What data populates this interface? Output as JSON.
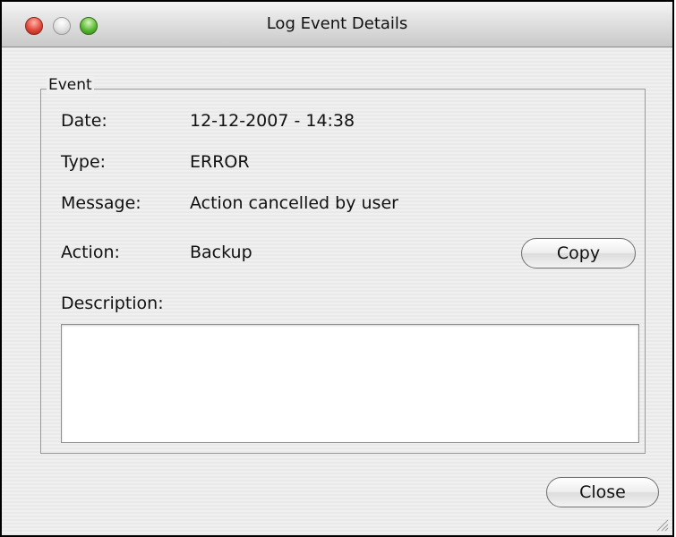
{
  "window": {
    "title": "Log Event Details"
  },
  "event": {
    "group_label": "Event",
    "date_label": "Date:",
    "date_value": "12-12-2007 - 14:38",
    "type_label": "Type:",
    "type_value": "ERROR",
    "message_label": "Message:",
    "message_value": "Action cancelled by user",
    "action_label": "Action:",
    "action_value": "Backup",
    "copy_button": "Copy",
    "description_label": "Description:",
    "description_value": ""
  },
  "footer": {
    "close_button": "Close"
  }
}
